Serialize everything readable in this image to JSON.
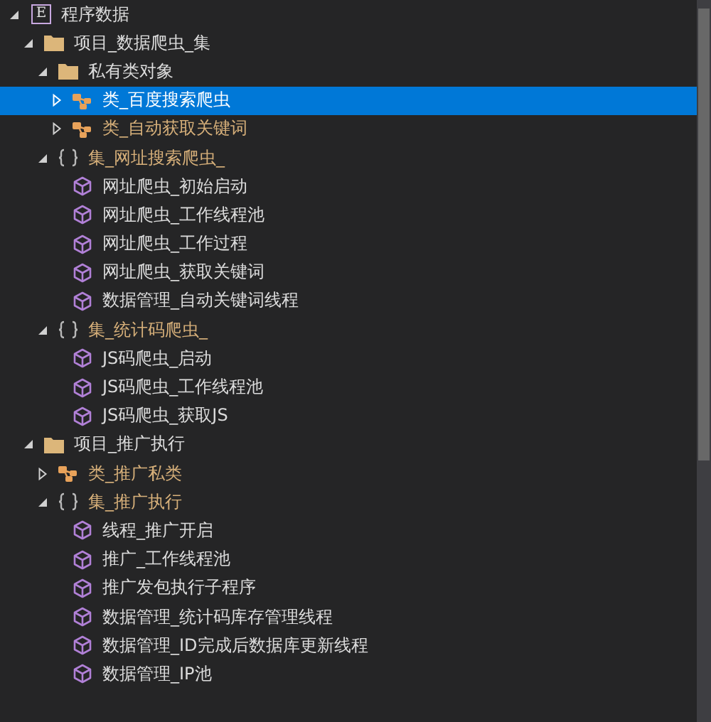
{
  "tree": [
    {
      "label": "程序数据",
      "kind": "root",
      "badge": "E",
      "expanded": true,
      "selected": false,
      "children": [
        {
          "label": "项目_数据爬虫_集",
          "kind": "folder",
          "expanded": true,
          "selected": false,
          "children": [
            {
              "label": "私有类对象",
              "kind": "folder",
              "expanded": true,
              "selected": false,
              "children": [
                {
                  "label": "类_百度搜索爬虫",
                  "kind": "class",
                  "expanded": false,
                  "selected": true
                },
                {
                  "label": "类_自动获取关键词",
                  "kind": "class",
                  "expanded": false,
                  "selected": false
                }
              ]
            },
            {
              "label": "集_网址搜索爬虫_",
              "kind": "module",
              "expanded": true,
              "selected": false,
              "children": [
                {
                  "label": "网址爬虫_初始启动",
                  "kind": "method",
                  "selected": false
                },
                {
                  "label": "网址爬虫_工作线程池",
                  "kind": "method",
                  "selected": false
                },
                {
                  "label": "网址爬虫_工作过程",
                  "kind": "method",
                  "selected": false
                },
                {
                  "label": "网址爬虫_获取关键词",
                  "kind": "method",
                  "selected": false
                },
                {
                  "label": "数据管理_自动关键词线程",
                  "kind": "method",
                  "selected": false
                }
              ]
            },
            {
              "label": "集_统计码爬虫_",
              "kind": "module",
              "expanded": true,
              "selected": false,
              "children": [
                {
                  "label": "JS码爬虫_启动",
                  "kind": "method",
                  "selected": false
                },
                {
                  "label": "JS码爬虫_工作线程池",
                  "kind": "method",
                  "selected": false
                },
                {
                  "label": "JS码爬虫_获取JS",
                  "kind": "method",
                  "selected": false
                }
              ]
            }
          ]
        },
        {
          "label": "项目_推广执行",
          "kind": "folder",
          "expanded": true,
          "selected": false,
          "children": [
            {
              "label": "类_推广私类",
              "kind": "class",
              "expanded": false,
              "selected": false
            },
            {
              "label": "集_推广执行",
              "kind": "module",
              "expanded": true,
              "selected": false,
              "children": [
                {
                  "label": "线程_推广开启",
                  "kind": "method",
                  "selected": false
                },
                {
                  "label": "推广_工作线程池",
                  "kind": "method",
                  "selected": false
                },
                {
                  "label": "推广发包执行子程序",
                  "kind": "method",
                  "selected": false
                },
                {
                  "label": "数据管理_统计码库存管理线程",
                  "kind": "method",
                  "selected": false
                },
                {
                  "label": "数据管理_ID完成后数据库更新线程",
                  "kind": "method",
                  "selected": false
                },
                {
                  "label": "数据管理_IP池",
                  "kind": "method",
                  "selected": false
                }
              ]
            }
          ]
        }
      ]
    }
  ]
}
